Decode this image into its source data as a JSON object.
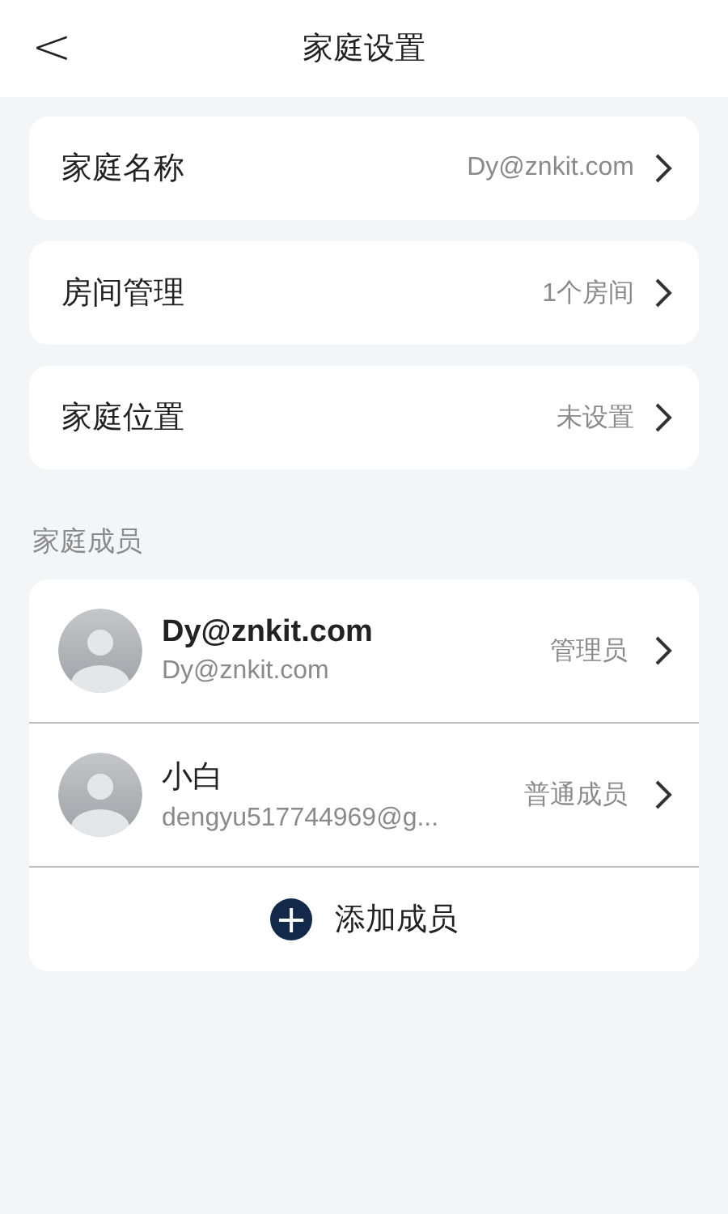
{
  "header": {
    "back": "<",
    "title": "家庭设置"
  },
  "settings": [
    {
      "label": "家庭名称",
      "value": "Dy@znkit.com"
    },
    {
      "label": "房间管理",
      "value": "1个房间"
    },
    {
      "label": "家庭位置",
      "value": "未设置"
    }
  ],
  "members_section": {
    "title": "家庭成员",
    "members": [
      {
        "name": "Dy@znkit.com",
        "account": "Dy@znkit.com",
        "role": "管理员",
        "name_bold": true
      },
      {
        "name": "小白",
        "account": "dengyu517744969@g...",
        "role": "普通成员",
        "name_bold": false
      }
    ],
    "add_button": {
      "icon": "+",
      "label": "添加成员"
    }
  }
}
